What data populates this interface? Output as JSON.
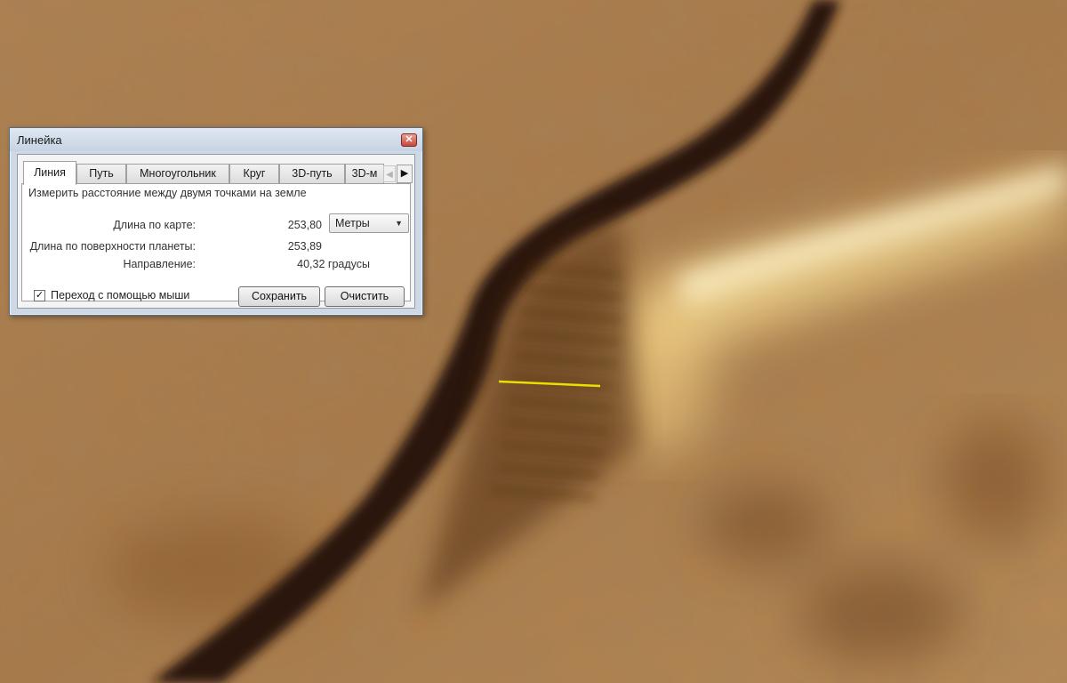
{
  "dialog": {
    "title": "Линейка",
    "tabs": [
      "Линия",
      "Путь",
      "Многоугольник",
      "Круг",
      "3D-путь",
      "3D-м"
    ],
    "description": "Измерить расстояние между двумя точками на земле",
    "map_length_label": "Длина по карте:",
    "map_length_value": "253,80",
    "unit": "Метры",
    "surface_length_label": "Длина по поверхности планеты:",
    "surface_length_value": "253,89",
    "heading_label": "Направление:",
    "heading_value": "40,32 градусы",
    "mouse_nav_label": "Переход с помощью мыши",
    "mouse_nav_checked": true,
    "save_label": "Сохранить",
    "clear_label": "Очистить"
  },
  "measure_line_color": "#e8e000"
}
